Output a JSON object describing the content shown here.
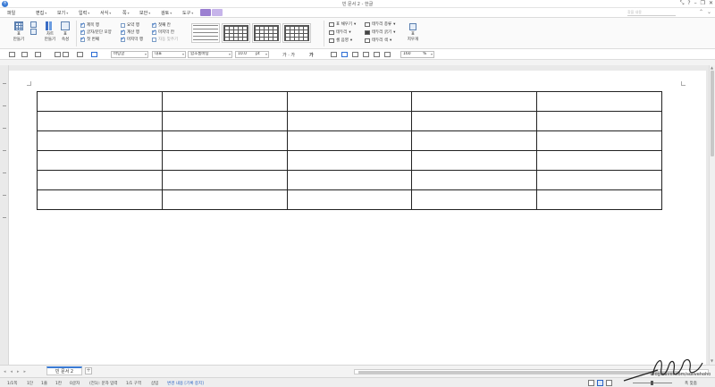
{
  "window": {
    "title": "빈 문서 2 - 한글",
    "controls": [
      "⤡",
      "?",
      "–",
      "❐",
      "✕"
    ]
  },
  "menu": {
    "items": [
      {
        "label": "파일"
      },
      {
        "label": "편집",
        "arrow": "▾"
      },
      {
        "label": "보기",
        "arrow": "▾"
      },
      {
        "label": "입력",
        "arrow": "▾"
      },
      {
        "label": "서식",
        "arrow": "▾"
      },
      {
        "label": "쪽",
        "arrow": "▾"
      },
      {
        "label": "보안",
        "arrow": "▾"
      },
      {
        "label": "검토",
        "arrow": "▾"
      },
      {
        "label": "도구",
        "arrow": "▾"
      }
    ],
    "search_placeholder": "찾을 내용",
    "right_icons": [
      "⌃",
      "⌄"
    ]
  },
  "ribbon": {
    "table_create_label": "표",
    "table_create_sub": "만들기",
    "cell_label": "셀",
    "chart_label": "차트",
    "chart_sub": "만들기",
    "table_props_label": "표",
    "table_props_sub": "속성",
    "options_col1": [
      {
        "label": "제목 행",
        "checked": true
      },
      {
        "label": "글자/문단 모양",
        "checked": true
      },
      {
        "label": "첫 번째",
        "checked": true
      }
    ],
    "options_col2": [
      {
        "label": "요약 행",
        "checked": false
      },
      {
        "label": "계산 행",
        "checked": true
      },
      {
        "label": "마지막 행",
        "checked": true
      }
    ],
    "options_col3": [
      {
        "label": "첫째 칸",
        "checked": true
      },
      {
        "label": "마지막 칸",
        "checked": true
      },
      {
        "label": "자동 맞추기",
        "checked": false,
        "disabled": true
      }
    ],
    "border_tools": [
      {
        "label": "표 채우기",
        "arrow": "▾"
      },
      {
        "label": "테두리",
        "arrow": "▾"
      },
      {
        "label": "셀 음영",
        "arrow": "▾"
      }
    ],
    "border_tools2": [
      {
        "label": "테두리 종류",
        "arrow": "▾"
      },
      {
        "label": "테두리 굵기",
        "arrow": "▾"
      },
      {
        "label": "테두리 색",
        "arrow": "▾"
      }
    ],
    "erase_label": "표",
    "erase_sub": "지우개"
  },
  "format_toolbar": {
    "style": "바탕글",
    "language": "대표",
    "font": "함초롬바탕",
    "size": "10.0",
    "size_unit": "pt",
    "char_spacing": "가 · 가",
    "zoom": "160",
    "zoom_unit": "%"
  },
  "table": {
    "rows": 6,
    "cols": 5
  },
  "tabs": {
    "nav": [
      "◂",
      "◂",
      "▸",
      "▸"
    ],
    "document_tab": "빈 문서 2",
    "add": "+"
  },
  "status": {
    "page": "1/1쪽",
    "section": "1단",
    "line": "1줄",
    "column": "1칸",
    "chars": "0글자",
    "mode": "(전1): 문자 입력",
    "section_info": "1/1 구역",
    "insert": "삽입",
    "track_changes": "변경 내용 [기록 중지]",
    "zoom_label": "폭 맞춤"
  },
  "watermark": {
    "text": "blog.naver.com/sdlivehoho"
  }
}
